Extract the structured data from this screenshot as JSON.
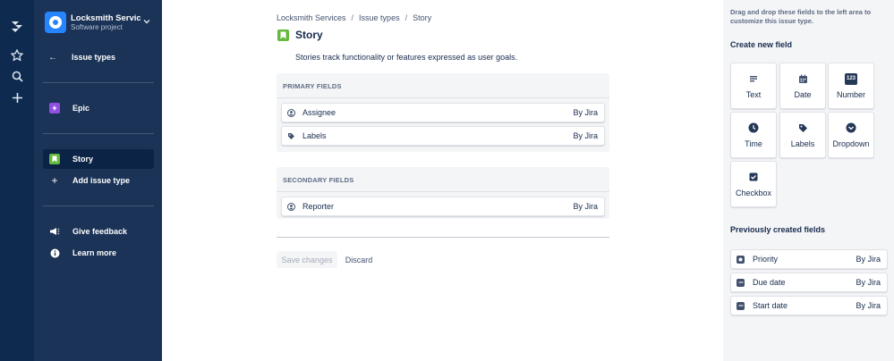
{
  "project": {
    "name": "Locksmith Servic...",
    "type": "Software project"
  },
  "sidebar": {
    "back_label": "Issue types",
    "epic": "Epic",
    "story": "Story",
    "add_issue_type": "Add issue type",
    "give_feedback": "Give feedback",
    "learn_more": "Learn more"
  },
  "breadcrumbs": [
    "Locksmith Services",
    "Issue types",
    "Story"
  ],
  "page": {
    "title": "Story",
    "description": "Stories track functionality or features expressed as user goals."
  },
  "primary": {
    "heading": "PRIMARY FIELDS",
    "fields": [
      {
        "label": "Assignee",
        "by": "By Jira",
        "icon": "user-icon"
      },
      {
        "label": "Labels",
        "by": "By Jira",
        "icon": "tag-icon"
      }
    ]
  },
  "secondary": {
    "heading": "SECONDARY FIELDS",
    "fields": [
      {
        "label": "Reporter",
        "by": "By Jira",
        "icon": "user-icon"
      }
    ]
  },
  "actions": {
    "save": "Save changes",
    "discard": "Discard"
  },
  "right": {
    "hint": "Drag and drop these fields to the left area to customize this issue type.",
    "create_heading": "Create new field",
    "tiles": [
      {
        "label": "Text",
        "icon": "text-icon"
      },
      {
        "label": "Date",
        "icon": "calendar-icon"
      },
      {
        "label": "Number",
        "icon": "number-icon",
        "glyph": "123"
      },
      {
        "label": "Time",
        "icon": "clock-icon"
      },
      {
        "label": "Labels",
        "icon": "tag-icon"
      },
      {
        "label": "Dropdown",
        "icon": "dropdown-icon"
      },
      {
        "label": "Checkbox",
        "icon": "checkbox-icon"
      }
    ],
    "prev_heading": "Previously created fields",
    "previous": [
      {
        "label": "Priority",
        "by": "By Jira",
        "icon": "priority-icon"
      },
      {
        "label": "Due date",
        "by": "By Jira",
        "icon": "calendar-icon"
      },
      {
        "label": "Start date",
        "by": "By Jira",
        "icon": "calendar-icon"
      }
    ]
  }
}
